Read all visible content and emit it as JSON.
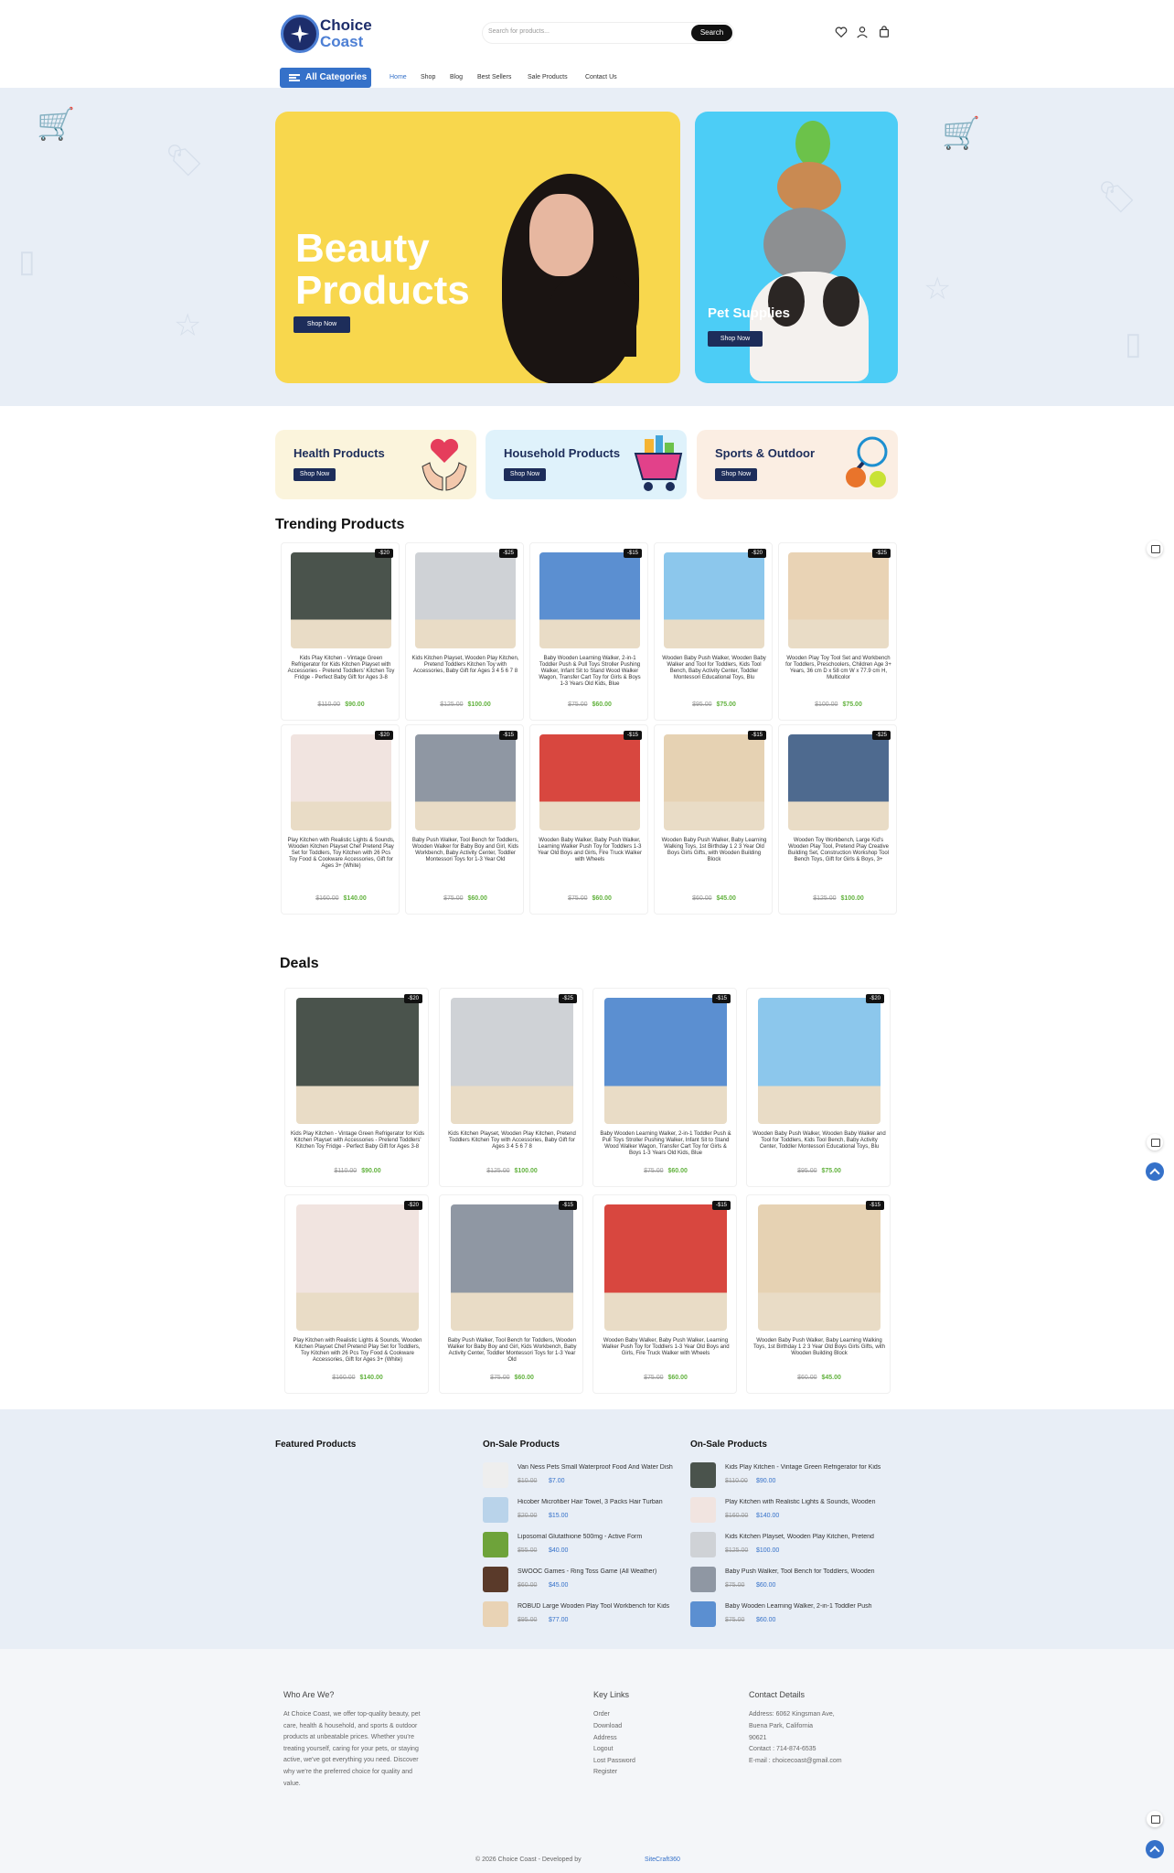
{
  "brand": {
    "name_line1": "Choice",
    "name_line2": "Coast"
  },
  "search": {
    "placeholder": "Search for products...",
    "button": "Search"
  },
  "header_icons": [
    "heart-icon",
    "user-icon",
    "cart-icon"
  ],
  "nav": {
    "categories_label": "All Categories",
    "links": [
      "Home",
      "Shop",
      "Blog",
      "Best Sellers",
      "Sale Products",
      "Contact Us"
    ],
    "active": "Home"
  },
  "hero": {
    "beauty_title": "Beauty Products",
    "beauty_cta": "Shop Now",
    "pet_title": "Pet Supplies",
    "pet_cta": "Shop Now"
  },
  "categories": [
    {
      "title": "Health Products",
      "cta": "Shop Now",
      "bg": "#fbf4dc",
      "icon": "heart-hands-icon"
    },
    {
      "title": "Household Products",
      "cta": "Shop Now",
      "bg": "#dff2fb",
      "icon": "shopping-basket-icon"
    },
    {
      "title": "Sports & Outdoor",
      "cta": "Shop Now",
      "bg": "#fbeee3",
      "icon": "sports-balls-icon"
    }
  ],
  "trending": {
    "title": "Trending Products",
    "products": [
      {
        "name": "Kids Play Kitchen - Vintage Green Refrigerator for Kids Kitchen Playset with Accessories - Pretend Toddlers' Kitchen Toy Fridge - Perfect Baby Gift for Ages 3-8",
        "old": "$110.00",
        "new": "$90.00",
        "badge": "-$20",
        "color": "#4a534c"
      },
      {
        "name": "Kids Kitchen Playset, Wooden Play Kitchen, Pretend Toddlers Kitchen Toy with Accessories, Baby Gift for Ages 3 4 5 6 7 8",
        "old": "$125.00",
        "new": "$100.00",
        "badge": "-$25",
        "color": "#cfd2d6"
      },
      {
        "name": "Baby Wooden Learning Walker, 2-in-1 Toddler Push & Pull Toys Stroller Pushing Walker, Infant Sit to Stand Wood Walker Wagon, Transfer Cart Toy for Girls & Boys 1-3 Years Old Kids, Blue",
        "old": "$75.00",
        "new": "$60.00",
        "badge": "-$15",
        "color": "#5b8fd1"
      },
      {
        "name": "Wooden Baby Push Walker, Wooden Baby Walker and Tool for Toddlers, Kids Tool Bench, Baby Activity Center, Toddler Montessori Educational Toys, Blu",
        "old": "$95.00",
        "new": "$75.00",
        "badge": "-$20",
        "color": "#8cc7ec"
      },
      {
        "name": "Wooden Play Toy Tool Set and Workbench for Toddlers, Preschoolers, Children Age 3+ Years, 36 cm D x 58 cm W x 77.9 cm H, Multicolor",
        "old": "$100.00",
        "new": "$75.00",
        "badge": "-$25",
        "color": "#e9d3b5"
      },
      {
        "name": "Play Kitchen with Realistic Lights & Sounds, Wooden Kitchen Playset Chef Pretend Play Set for Toddlers, Toy Kitchen with 26 Pcs Toy Food & Cookware Accessories, Gift for Ages 3+ (White)",
        "old": "$160.00",
        "new": "$140.00",
        "badge": "-$20",
        "color": "#f1e4e0"
      },
      {
        "name": "Baby Push Walker, Tool Bench for Toddlers, Wooden Walker for Baby Boy and Girl, Kids Workbench, Baby Activity Center, Toddler Montessori Toys for 1-3 Year Old",
        "old": "$75.00",
        "new": "$60.00",
        "badge": "-$15",
        "color": "#8f97a3"
      },
      {
        "name": "Wooden Baby Walker, Baby Push Walker, Learning Walker Push Toy for Toddlers 1-3 Year Old Boys and Girls, Fire Truck Walker with Wheels",
        "old": "$75.00",
        "new": "$60.00",
        "badge": "-$15",
        "color": "#d8473f"
      },
      {
        "name": "Wooden Baby Push Walker, Baby Learning Walking Toys, 1st Birthday 1 2 3 Year Old Boys Girls Gifts, with Wooden Building Block",
        "old": "$60.00",
        "new": "$45.00",
        "badge": "-$15",
        "color": "#e6d2b3"
      },
      {
        "name": "Wooden Toy Workbench, Large Kid's Wooden Play Tool, Pretend Play Creative Building Set, Construction Workshop Tool Bench Toys, Gift for Girls & Boys, 3+",
        "old": "$125.00",
        "new": "$100.00",
        "badge": "-$25",
        "color": "#4e6a8f"
      }
    ]
  },
  "deals": {
    "title": "Deals",
    "products": [
      {
        "name": "Kids Play Kitchen - Vintage Green Refrigerator for Kids Kitchen Playset with Accessories - Pretend Toddlers' Kitchen Toy Fridge - Perfect Baby Gift for Ages 3-8",
        "old": "$110.00",
        "new": "$90.00",
        "badge": "-$20",
        "color": "#4a534c"
      },
      {
        "name": "Kids Kitchen Playset, Wooden Play Kitchen, Pretend Toddlers Kitchen Toy with Accessories, Baby Gift for Ages 3 4 5 6 7 8",
        "old": "$125.00",
        "new": "$100.00",
        "badge": "-$25",
        "color": "#cfd2d6"
      },
      {
        "name": "Baby Wooden Learning Walker, 2-in-1 Toddler Push & Pull Toys Stroller Pushing Walker, Infant Sit to Stand Wood Walker Wagon, Transfer Cart Toy for Girls & Boys 1-3 Years Old Kids, Blue",
        "old": "$75.00",
        "new": "$60.00",
        "badge": "-$15",
        "color": "#5b8fd1"
      },
      {
        "name": "Wooden Baby Push Walker, Wooden Baby Walker and Tool for Toddlers, Kids Tool Bench, Baby Activity Center, Toddler Montessori Educational Toys, Blu",
        "old": "$95.00",
        "new": "$75.00",
        "badge": "-$20",
        "color": "#8cc7ec"
      },
      {
        "name": "Play Kitchen with Realistic Lights & Sounds, Wooden Kitchen Playset Chef Pretend Play Set for Toddlers, Toy Kitchen with 26 Pcs Toy Food & Cookware Accessories, Gift for Ages 3+ (White)",
        "old": "$160.00",
        "new": "$140.00",
        "badge": "-$20",
        "color": "#f1e4e0"
      },
      {
        "name": "Baby Push Walker, Tool Bench for Toddlers, Wooden Walker for Baby Boy and Girl, Kids Workbench, Baby Activity Center, Toddler Montessori Toys for 1-3 Year Old",
        "old": "$75.00",
        "new": "$60.00",
        "badge": "-$15",
        "color": "#8f97a3"
      },
      {
        "name": "Wooden Baby Walker, Baby Push Walker, Learning Walker Push Toy for Toddlers 1-3 Year Old Boys and Girls, Fire Truck Walker with Wheels",
        "old": "$75.00",
        "new": "$60.00",
        "badge": "-$15",
        "color": "#d8473f"
      },
      {
        "name": "Wooden Baby Push Walker, Baby Learning Walking Toys, 1st Birthday 1 2 3 Year Old Boys Girls Gifts, with Wooden Building Block",
        "old": "$60.00",
        "new": "$45.00",
        "badge": "-$15",
        "color": "#e6d2b3"
      }
    ]
  },
  "featured": {
    "col1_title": "Featured Products",
    "col2_title": "On-Sale Products",
    "col2": [
      {
        "name": "Van Ness Pets Small Waterproof Food And Water Dish",
        "old": "$10.00",
        "new": "$7.00",
        "color": "#eeeeee"
      },
      {
        "name": "Hicober Microfiber Hair Towel, 3 Packs Hair Turban",
        "old": "$20.00",
        "new": "$15.00",
        "color": "#b9d3ea"
      },
      {
        "name": "Liposomal Glutathione 500mg - Active Form",
        "old": "$55.00",
        "new": "$40.00",
        "color": "#6ea33a"
      },
      {
        "name": "SWOOC Games - Ring Toss Game (All Weather)",
        "old": "$60.00",
        "new": "$45.00",
        "color": "#5a3a2a"
      },
      {
        "name": "ROBUD Large Wooden Play Tool Workbench for Kids",
        "old": "$95.00",
        "new": "$77.00",
        "color": "#e9d3b5"
      }
    ],
    "col3_title": "On-Sale Products",
    "col3": [
      {
        "name": "Kids Play Kitchen - Vintage Green Refrigerator for Kids",
        "old": "$110.00",
        "new": "$90.00",
        "color": "#4a534c"
      },
      {
        "name": "Play Kitchen with Realistic Lights & Sounds, Wooden",
        "old": "$160.00",
        "new": "$140.00",
        "color": "#f1e4e0"
      },
      {
        "name": "Kids Kitchen Playset, Wooden Play Kitchen, Pretend",
        "old": "$125.00",
        "new": "$100.00",
        "color": "#cfd2d6"
      },
      {
        "name": "Baby Push Walker, Tool Bench for Toddlers, Wooden",
        "old": "$75.00",
        "new": "$60.00",
        "color": "#8f97a3"
      },
      {
        "name": "Baby Wooden Learning Walker, 2-in-1 Toddler Push",
        "old": "$75.00",
        "new": "$60.00",
        "color": "#5b8fd1"
      }
    ]
  },
  "footer": {
    "about_title": "Who Are We?",
    "about_text": "At Choice Coast, we offer top-quality beauty, pet care, health & household, and sports & outdoor products at unbeatable prices. Whether you're treating yourself, caring for your pets, or staying active, we've got everything you need. Discover why we're the preferred choice for quality and value.",
    "links_title": "Key Links",
    "links": [
      "Order",
      "Download",
      "Address",
      "Logout",
      "Lost Password",
      "Register"
    ],
    "contact_title": "Contact Details",
    "contact": [
      "Address: 6062 Kingsman Ave,",
      "Buena Park, California",
      "90621",
      "Contact : 714-874-6535",
      "E-mail : choicecoast@gmail.com"
    ],
    "copyright": "© 2026   Choice Coast    -    Developed by",
    "developer": "SiteCraft360"
  },
  "colors": {
    "accent": "#3571c9",
    "price_green": "#62b23e",
    "hero_yellow": "#f8d74d",
    "hero_blue": "#4ccdf6"
  }
}
